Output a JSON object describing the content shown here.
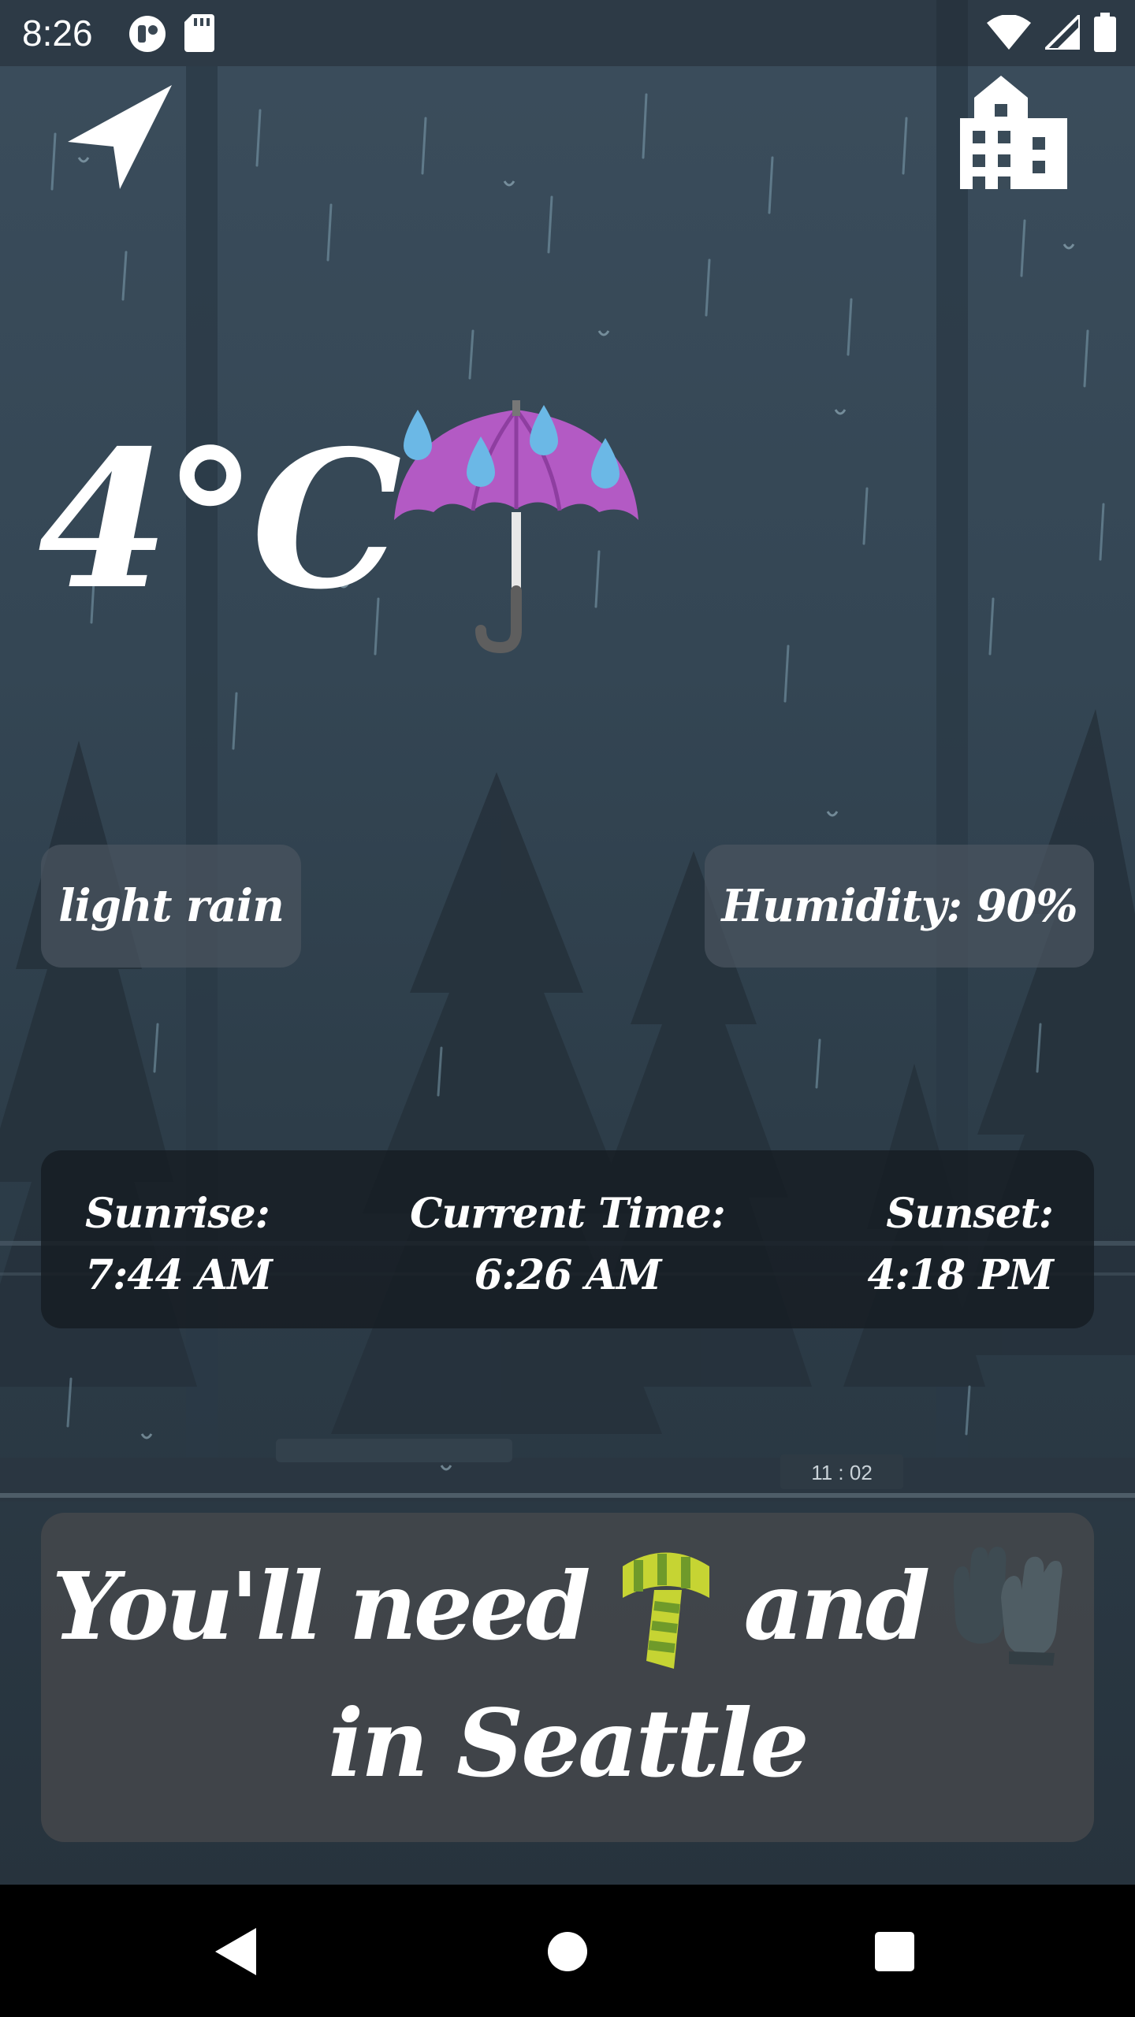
{
  "status_bar": {
    "time": "8:26",
    "left_icons": [
      "notification-app-icon",
      "sd-card-icon"
    ],
    "right_icons": [
      "wifi-icon",
      "cellular-signal-icon",
      "battery-icon"
    ]
  },
  "header": {
    "location_icon": "navigation-arrow-icon",
    "city_icon": "city-building-icon"
  },
  "weather": {
    "temperature": "4°C",
    "condition_icon": "umbrella-with-rain-drops-emoji",
    "description": "light rain",
    "humidity": "Humidity: 90%"
  },
  "times": {
    "sunrise_label": "Sunrise:",
    "sunrise_value": "7:44 AM",
    "current_label": "Current Time:",
    "current_value": "6:26 AM",
    "sunset_label": "Sunset:",
    "sunset_value": "4:18 PM"
  },
  "advice": {
    "part1": "You'll need",
    "item1_icon": "scarf-emoji",
    "part2": "and",
    "item2_icon": "gloves-emoji",
    "line2": "in Seattle"
  },
  "background": {
    "clock_label": "11 : 02"
  },
  "nav_bar": {
    "back_icon": "back-triangle-icon",
    "home_icon": "home-circle-icon",
    "recents_icon": "recents-square-icon"
  },
  "colors": {
    "sky_top": "#3b4d5c",
    "sky_bottom": "#27333d",
    "umbrella": "#b35ac4",
    "raindrop": "#6bb8e6",
    "scarf_yellow": "#c6d433",
    "scarf_green": "#6f9a2a",
    "gloves": "#3e4b52"
  }
}
